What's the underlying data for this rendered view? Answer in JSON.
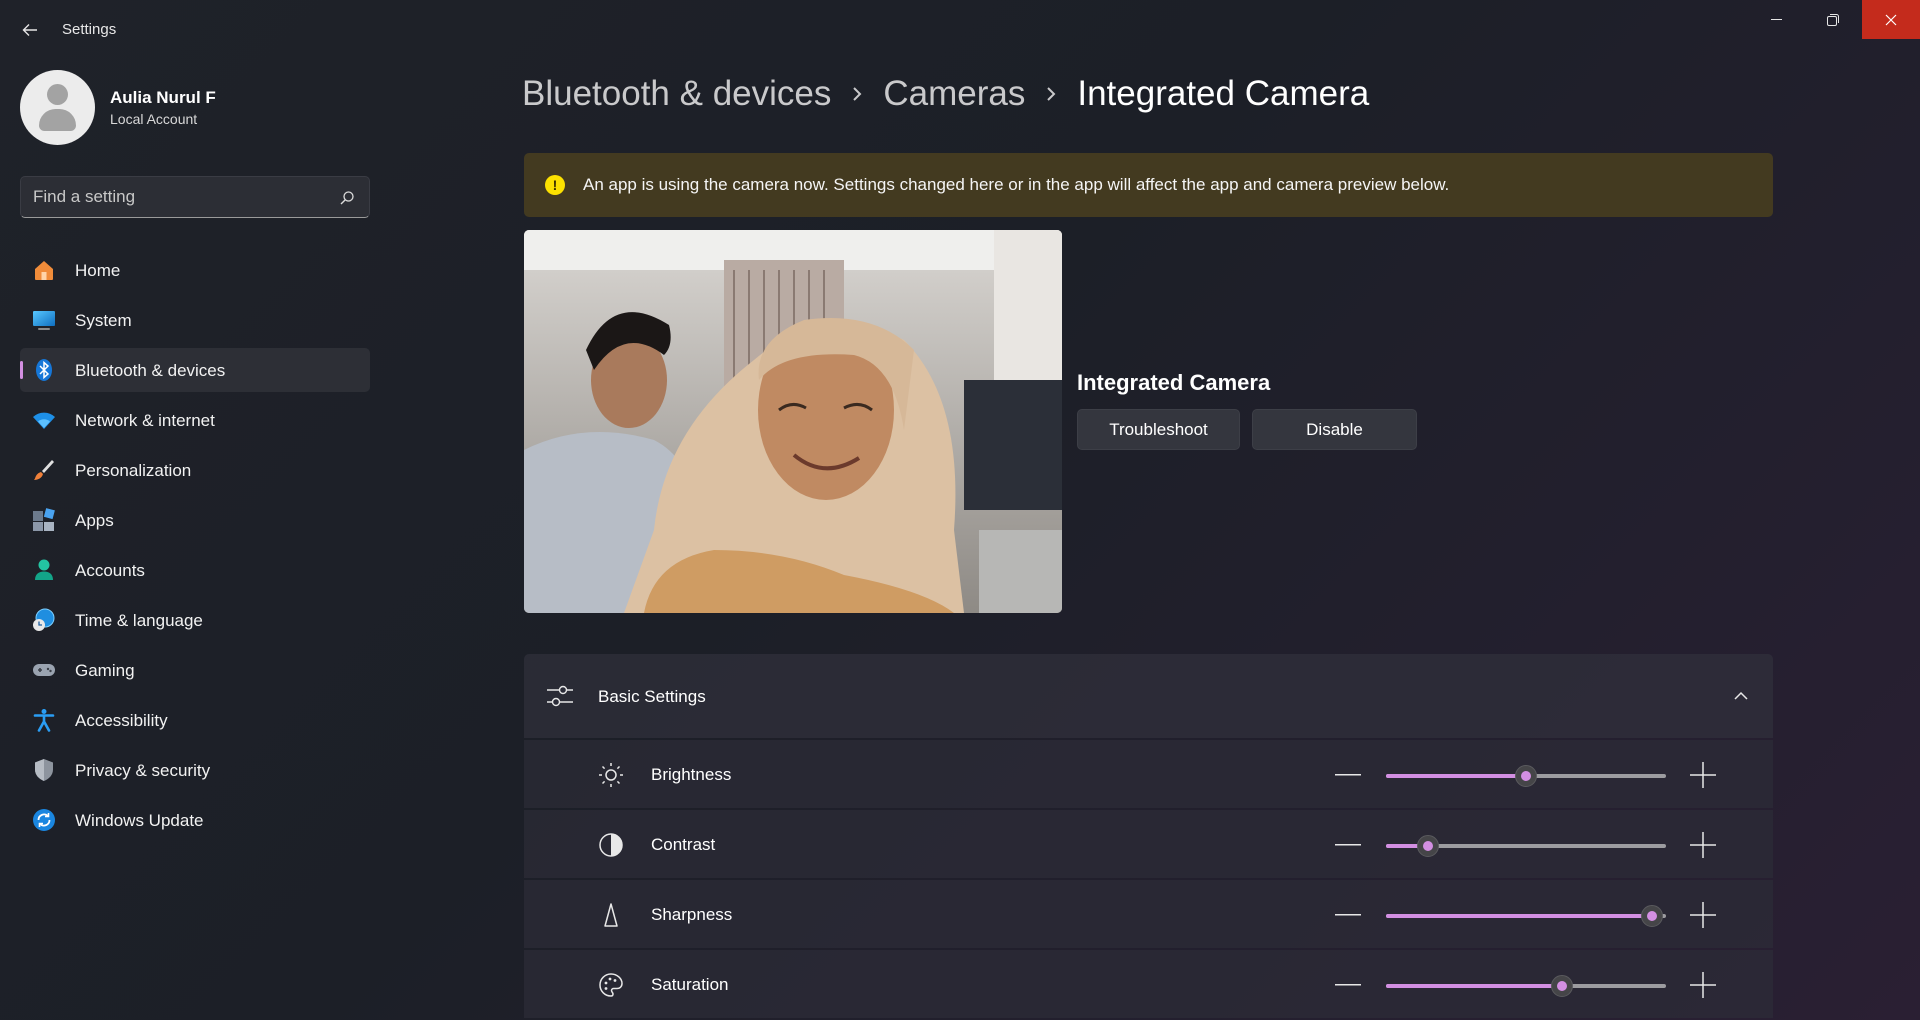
{
  "window": {
    "title": "Settings"
  },
  "user": {
    "name": "Aulia Nurul F",
    "account_type": "Local Account"
  },
  "search": {
    "placeholder": "Find a setting"
  },
  "nav": {
    "items": [
      {
        "label": "Home",
        "icon": "home-icon",
        "active": false
      },
      {
        "label": "System",
        "icon": "system-icon",
        "active": false
      },
      {
        "label": "Bluetooth & devices",
        "icon": "bluetooth-icon",
        "active": true
      },
      {
        "label": "Network & internet",
        "icon": "wifi-icon",
        "active": false
      },
      {
        "label": "Personalization",
        "icon": "brush-icon",
        "active": false
      },
      {
        "label": "Apps",
        "icon": "apps-icon",
        "active": false
      },
      {
        "label": "Accounts",
        "icon": "accounts-icon",
        "active": false
      },
      {
        "label": "Time & language",
        "icon": "globe-clock-icon",
        "active": false
      },
      {
        "label": "Gaming",
        "icon": "gamepad-icon",
        "active": false
      },
      {
        "label": "Accessibility",
        "icon": "accessibility-icon",
        "active": false
      },
      {
        "label": "Privacy & security",
        "icon": "shield-icon",
        "active": false
      },
      {
        "label": "Windows Update",
        "icon": "update-icon",
        "active": false
      }
    ]
  },
  "breadcrumb": [
    "Bluetooth & devices",
    "Cameras",
    "Integrated Camera"
  ],
  "banner": {
    "text": "An app is using the camera now. Settings changed here or in the app will affect the app and camera preview below."
  },
  "camera": {
    "name": "Integrated Camera",
    "troubleshoot_label": "Troubleshoot",
    "disable_label": "Disable"
  },
  "basic_settings": {
    "title": "Basic Settings",
    "sliders": [
      {
        "label": "Brightness",
        "icon": "sun-icon",
        "value_percent": 50
      },
      {
        "label": "Contrast",
        "icon": "contrast-icon",
        "value_percent": 15
      },
      {
        "label": "Sharpness",
        "icon": "sharpness-icon",
        "value_percent": 95
      },
      {
        "label": "Saturation",
        "icon": "palette-icon",
        "value_percent": 63
      }
    ]
  },
  "colors": {
    "accent": "#d38fe2",
    "banner_bg": "#433a20",
    "close_button": "#c42b1c"
  }
}
